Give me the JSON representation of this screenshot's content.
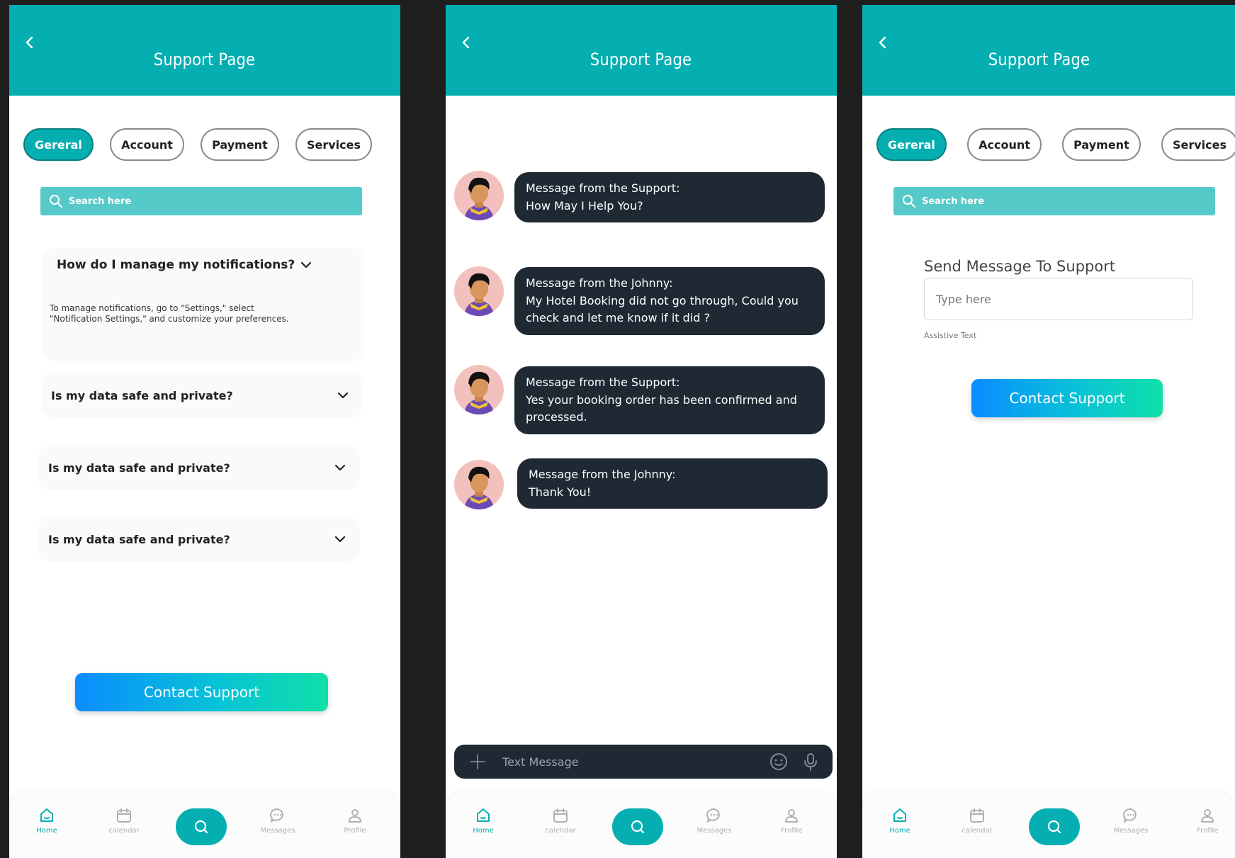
{
  "app": {
    "title": "Support Page",
    "accent_color": "#05afb1",
    "bubble_color": "#1e2934"
  },
  "tabs": [
    {
      "label": "Gereral",
      "active": true
    },
    {
      "label": "Account",
      "active": false
    },
    {
      "label": "Payment",
      "active": false
    },
    {
      "label": "Services",
      "active": false
    }
  ],
  "search": {
    "placeholder": "Search here"
  },
  "faq": {
    "open_question": "How do I manage my notifications?",
    "open_answer_line1": "To manage notifications, go to \"Settings,\" select",
    "open_answer_line2": "\"Notification Settings,\" and customize your preferences.",
    "items": [
      {
        "question": "Is my data safe and private?"
      },
      {
        "question": "Is my data safe and private?"
      },
      {
        "question": "Is my data safe and private?"
      }
    ]
  },
  "contact_button": {
    "label": "Contact Support"
  },
  "chat": {
    "messages": [
      {
        "lines": [
          "Message from the Support:",
          "How May I Help You?"
        ]
      },
      {
        "lines": [
          "Message from the Johnny:",
          "My Hotel Booking did not go through, Could you",
          "check and let me know if it did ?"
        ]
      },
      {
        "lines": [
          "Message from the Support:",
          "Yes your booking order has been confirmed and",
          "processed."
        ]
      },
      {
        "lines": [
          "Message from the Johnny:",
          "Thank You!"
        ]
      }
    ],
    "input_placeholder": "Text Message",
    "icons": [
      "plus-icon",
      "emoji-icon",
      "microphone-icon"
    ]
  },
  "form": {
    "title": "Send Message To Support",
    "input_placeholder": "Type here",
    "assistive_text": "Assistive Text"
  },
  "nav": {
    "items": [
      {
        "label": "Home",
        "icon": "home-icon",
        "active": true
      },
      {
        "label": "calendar",
        "icon": "calendar-icon",
        "active": false
      },
      {
        "label": "",
        "icon": "search-icon",
        "center": true
      },
      {
        "label": "Messages",
        "icon": "messages-icon",
        "active": false
      },
      {
        "label": "Profile",
        "icon": "profile-icon",
        "active": false
      }
    ]
  }
}
